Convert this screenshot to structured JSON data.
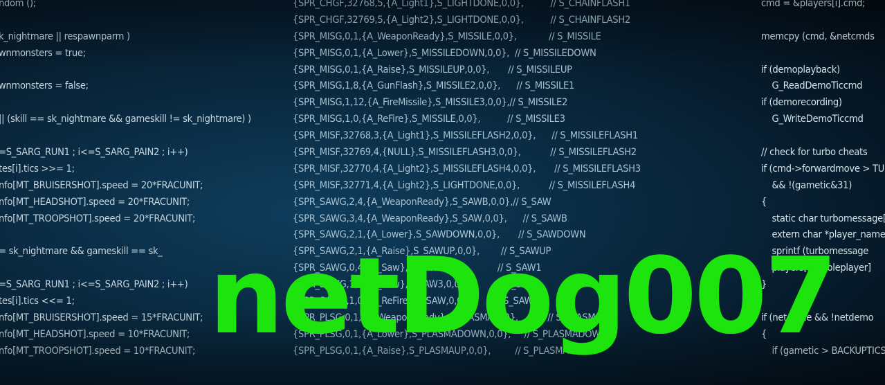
{
  "logo": {
    "text": "netDog007",
    "color": "#1ee40e"
  },
  "background_code": {
    "left_column": [
      "ndom ();",
      "",
      "k_nightmare || respawnparm )",
      "wnmonsters = true;",
      "",
      "wnmonsters = false;",
      "",
      "|| (skill == sk_nightmare && gameskill != sk_nightmare) )",
      "",
      "=S_SARG_RUN1 ; i<=S_SARG_PAIN2 ; i++)",
      "tes[i].tics >>= 1;",
      "nfo[MT_BRUISERSHOT].speed = 20*FRACUNIT;",
      "nfo[MT_HEADSHOT].speed = 20*FRACUNIT;",
      "nfo[MT_TROOPSHOT].speed = 20*FRACUNIT;",
      "",
      "= sk_nightmare && gameskill == sk_",
      "",
      "=S_SARG_RUN1 ; i<=S_SARG_PAIN2 ; i++)",
      "tes[i].tics <<= 1;",
      "nfo[MT_BRUISERSHOT].speed = 15*FRACUNIT;",
      "nfo[MT_HEADSHOT].speed = 10*FRACUNIT;",
      "nfo[MT_TROOPSHOT].speed = 10*FRACUNIT;"
    ],
    "middle_column": [
      "{SPR_CHGF,32768,5,{A_Light1},S_LIGHTDONE,0,0},          // S_CHAINFLASH1",
      "{SPR_CHGF,32769,5,{A_Light2},S_LIGHTDONE,0,0},          // S_CHAINFLASH2",
      "{SPR_MISG,0,1,{A_WeaponReady},S_MISSILE,0,0},            // S_MISSILE",
      "{SPR_MISG,0,1,{A_Lower},S_MISSILEDOWN,0,0},  // S_MISSILEDOWN",
      "{SPR_MISG,0,1,{A_Raise},S_MISSILEUP,0,0},       // S_MISSILEUP",
      "{SPR_MISG,1,8,{A_GunFlash},S_MISSILE2,0,0},      // S_MISSILE1",
      "{SPR_MISG,1,12,{A_FireMissile},S_MISSILE3,0,0},// S_MISSILE2",
      "{SPR_MISG,1,0,{A_ReFire},S_MISSILE,0,0},          // S_MISSILE3",
      "{SPR_MISF,32768,3,{A_Light1},S_MISSILEFLASH2,0,0},      // S_MISSILEFLASH1",
      "{SPR_MISF,32769,4,{NULL},S_MISSILEFLASH3,0,0},           // S_MISSILEFLASH2",
      "{SPR_MISF,32770,4,{A_Light2},S_MISSILEFLASH4,0,0},       // S_MISSILEFLASH3",
      "{SPR_MISF,32771,4,{A_Light2},S_LIGHTDONE,0,0},           // S_MISSILEFLASH4",
      "{SPR_SAWG,2,4,{A_WeaponReady},S_SAWB,0,0},// S_SAW",
      "{SPR_SAWG,3,4,{A_WeaponReady},S_SAW,0,0},      // S_SAWB",
      "{SPR_SAWG,2,1,{A_Lower},S_SAWDOWN,0,0},       // S_SAWDOWN",
      "{SPR_SAWG,2,1,{A_Raise},S_SAWUP,0,0},        // S_SAWUP",
      "{SPR_SAWG,0,4,{A_Saw},S_SAW2,0,0},           // S_SAW1",
      "{SPR_SAWG,1,4,{A_Saw},S_SAW3,0,0},           // S_SAW2",
      "{SPR_SAWG,1,0,{A_ReFire},S_SAW,0,0},         // S_SAW3",
      "{SPR_PLSG,0,1,{A_WeaponReady},S_PLASMA,0,0},           // S_PLASMA",
      "{SPR_PLSG,0,1,{A_Lower},S_PLASMADOWN,0,0},     // S_PLASMADOWN",
      "{SPR_PLSG,0,1,{A_Raise},S_PLASMAUP,0,0},         // S_PLASMAUP"
    ],
    "right_column": [
      "cmd = &players[i].cmd;",
      "",
      "memcpy (cmd, &netcmds",
      "",
      "if (demoplayback)",
      "    G_ReadDemoTiccmd",
      "if (demorecording)",
      "    G_WriteDemoTiccmd",
      "",
      "// check for turbo cheats",
      "if (cmd->forwardmove > TURBOTHRESHOLD",
      "    && !(gametic&31)",
      "{",
      "    static char turbomessage[80];",
      "    extern char *player_names[4];",
      "    sprintf (turbomessage",
      "    players[consoleplayer]",
      "}",
      "",
      "if (netgame && !netdemo",
      "{",
      "    if (gametic > BACKUPTICS"
    ]
  }
}
